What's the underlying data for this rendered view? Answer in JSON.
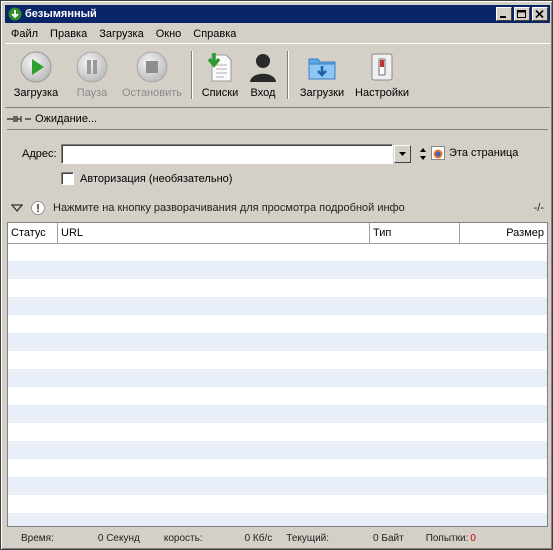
{
  "window": {
    "title": "безымянный"
  },
  "menu": [
    "Файл",
    "Правка",
    "Загрузка",
    "Окно",
    "Справка"
  ],
  "toolbar": {
    "download": "Загрузка",
    "pause": "Пауза",
    "stop": "Остановить",
    "lists": "Списки",
    "login": "Вход",
    "downloads": "Загрузки",
    "settings": "Настройки"
  },
  "status": {
    "text": "Ожидание..."
  },
  "address": {
    "label": "Адрес:",
    "value": "",
    "this_page": "Эта страница"
  },
  "auth": {
    "label": "Авторизация (необязательно)"
  },
  "info": {
    "text": "Нажмите на кнопку разворачивания для просмотра подробной инфо",
    "counter": "-/-"
  },
  "table": {
    "columns": [
      "Статус",
      "URL",
      "Тип",
      "Размер"
    ]
  },
  "footer": {
    "time_label": "Время:",
    "time_value": "0 Секунд",
    "speed_label": "корость:",
    "speed_value": "0 Кб/с",
    "current_label": "Текущий:",
    "current_value": "0 Байт",
    "attempts_label": "Попытки:",
    "attempts_value": "0"
  },
  "colors": {
    "titlebar": "#0a246a",
    "row_alt": "#e8eef8",
    "attempts": "#d00000"
  }
}
